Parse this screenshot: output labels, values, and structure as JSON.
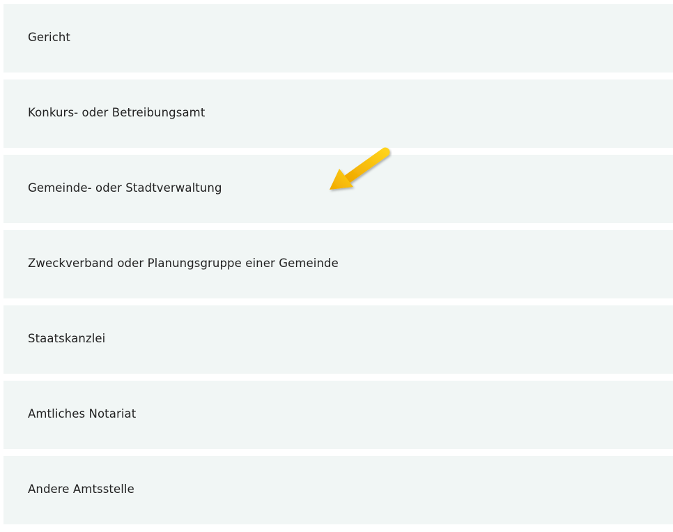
{
  "options": [
    {
      "label": "Gericht"
    },
    {
      "label": "Konkurs- oder Betreibungsamt"
    },
    {
      "label": "Gemeinde- oder Stadtverwaltung"
    },
    {
      "label": "Zweckverband oder Planungsgruppe einer Gemeinde"
    },
    {
      "label": "Staatskanzlei"
    },
    {
      "label": "Amtliches Notariat"
    },
    {
      "label": "Andere Amtsstelle"
    }
  ],
  "annotation": {
    "icon": "arrow-pointer-icon",
    "color": "#f5b800",
    "points_to_option": 2
  },
  "colors": {
    "item_background": "#f1f6f5",
    "text": "#222222",
    "page_background": "#ffffff"
  }
}
